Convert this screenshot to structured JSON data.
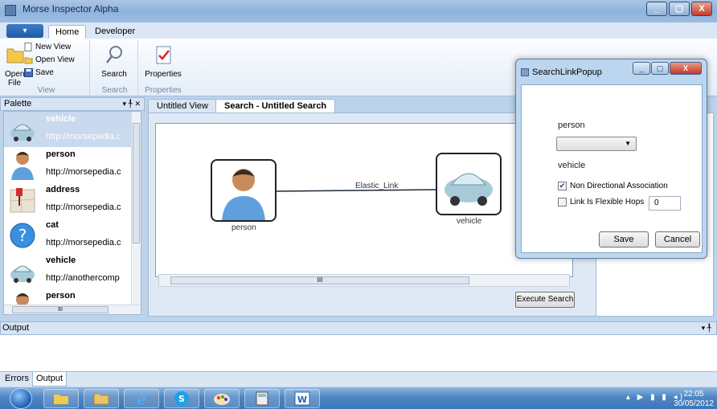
{
  "window": {
    "title": "Morse Inspector Alpha",
    "min": "_",
    "max": "▢",
    "close": "X"
  },
  "ribbon": {
    "app_menu": "▾",
    "tabs": [
      "Home",
      "Developer"
    ],
    "view_group": {
      "open_file": "Open File",
      "new_view": "New View",
      "open_view": "Open View",
      "save": "Save",
      "label": "View"
    },
    "search_group": {
      "search": "Search",
      "label": "Search"
    },
    "properties_group": {
      "properties": "Properties",
      "label": "Properties"
    }
  },
  "palette": {
    "title": "Palette",
    "tools": "▾ ╀ ✕",
    "items": [
      {
        "name": "vehicle",
        "url": "http://morsepedia.c",
        "icon": "car-icon",
        "selected": true
      },
      {
        "name": "person",
        "url": "http://morsepedia.c",
        "icon": "person-icon"
      },
      {
        "name": "address",
        "url": "http://morsepedia.c",
        "icon": "map-pin-icon"
      },
      {
        "name": "cat",
        "url": "http://morsepedia.c",
        "icon": "help-icon"
      },
      {
        "name": "vehicle",
        "url": "http://anothercomp",
        "icon": "car-icon"
      },
      {
        "name": "person",
        "url": "",
        "icon": "person-icon"
      }
    ],
    "scroll_grip": "III"
  },
  "documents": {
    "tabs": [
      "Untitled View",
      "Search - Untitled Search"
    ],
    "graph": {
      "nodes": [
        {
          "label": "person"
        },
        {
          "label": "vehicle"
        }
      ],
      "edge_label": "Elastic_Link"
    },
    "scroll_grip": "III",
    "execute_button": "Execute Search"
  },
  "popup": {
    "title": "SearchLinkPopup",
    "source_label": "person",
    "combo_value": "",
    "target_label": "vehicle",
    "non_directional": {
      "label": "Non Directional Association",
      "checked": true
    },
    "flexible_hops": {
      "label": "Link Is Flexible  Hops",
      "checked": false,
      "value": "0"
    },
    "save": "Save",
    "cancel": "Cancel"
  },
  "output": {
    "title": "Output",
    "tools": "▾ ╀",
    "tabs": [
      "Errors",
      "Output"
    ]
  },
  "taskbar": {
    "time": "22:05",
    "date": "30/05/2012"
  }
}
